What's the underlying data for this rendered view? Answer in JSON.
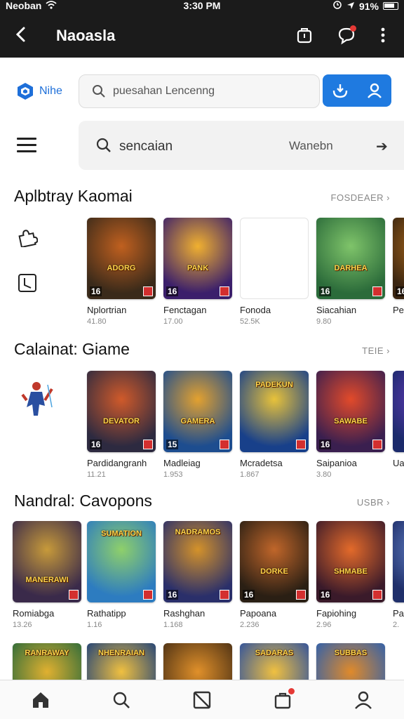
{
  "status": {
    "carrier": "Neoban",
    "time": "3:30 PM",
    "battery": "91%"
  },
  "appbar": {
    "title": "Naoasla"
  },
  "brand": {
    "name": "Nihe"
  },
  "search": {
    "placeholder": "puesahan Lencenng"
  },
  "search2": {
    "text": "sencaian",
    "hint": "Wanebn"
  },
  "sections": [
    {
      "title": "Aplbtray  Kaomai",
      "more": "FOSDEAER",
      "apps": [
        {
          "name": "Nplortrian",
          "meta": "41.80",
          "logo": "ADORG",
          "age": "16",
          "colors": [
            "#3a2a1a",
            "#c0601f"
          ]
        },
        {
          "name": "Fenctagan",
          "meta": "17.00",
          "logo": "PANK",
          "age": "16",
          "colors": [
            "#3b1f6b",
            "#f0b030"
          ]
        },
        {
          "name": "Fonoda",
          "meta": "52.5K",
          "logo": "",
          "age": "",
          "colors": [
            "#ffffff",
            "#ffffff"
          ]
        },
        {
          "name": "Siacahian",
          "meta": "9.80",
          "logo": "DARHEA",
          "age": "16",
          "colors": [
            "#2b6b3a",
            "#7fc46a"
          ]
        },
        {
          "name": "Pe",
          "meta": "",
          "logo": "",
          "age": "16",
          "colors": [
            "#3a2510",
            "#b8701c"
          ]
        }
      ]
    },
    {
      "title": "Calainat: Giame",
      "more": "TEIE",
      "apps": [
        {
          "name": "Pardidangranh",
          "meta": "11.21",
          "logo": "DEVATOR",
          "age": "16",
          "colors": [
            "#2d2a40",
            "#d05a2a"
          ]
        },
        {
          "name": "Madleiag",
          "meta": "1.953",
          "logo": "GAMERA",
          "age": "15",
          "colors": [
            "#1d4d8f",
            "#e3a12f"
          ]
        },
        {
          "name": "Mcradetsa",
          "meta": "1.867",
          "logo": "PADEKUN",
          "age": "",
          "colors": [
            "#18408a",
            "#e8c23a"
          ]
        },
        {
          "name": "Saipanioa",
          "meta": "3.80",
          "logo": "SAWABE",
          "age": "16",
          "colors": [
            "#3a1f4f",
            "#e24a2a"
          ]
        },
        {
          "name": "Ua",
          "meta": "",
          "logo": "",
          "age": "",
          "colors": [
            "#1b2a6b",
            "#6a3cc0"
          ]
        }
      ]
    },
    {
      "title": "Nandral: Cavopons",
      "more": "USBR",
      "apps": [
        {
          "name": "Romiabga",
          "meta": "13.26",
          "logo": "MANERAWI",
          "age": "",
          "colors": [
            "#3a2a4a",
            "#c79a3a"
          ]
        },
        {
          "name": "Rathatipp",
          "meta": "1.16",
          "logo": "SUMATION",
          "age": "",
          "colors": [
            "#2d7cc0",
            "#8fd06a"
          ]
        },
        {
          "name": "Rashghan",
          "meta": "1.168",
          "logo": "NADRAMOS",
          "age": "16",
          "colors": [
            "#2a2f6a",
            "#d4922a"
          ]
        },
        {
          "name": "Papoana",
          "meta": "2.236",
          "logo": "DORKE",
          "age": "16",
          "colors": [
            "#2a1f14",
            "#c0662a"
          ]
        },
        {
          "name": "Fapiohing",
          "meta": "2.96",
          "logo": "SHMABE",
          "age": "16",
          "colors": [
            "#3a1a2a",
            "#e36a2a"
          ]
        },
        {
          "name": "Pa",
          "meta": "2.",
          "logo": "",
          "age": "",
          "colors": [
            "#1f2f6a",
            "#6a8ad0"
          ]
        }
      ]
    },
    {
      "title": "",
      "more": "",
      "apps": [
        {
          "name": "",
          "meta": "",
          "logo": "RANRAWAY",
          "age": "",
          "colors": [
            "#2a6a3a",
            "#e0b030"
          ]
        },
        {
          "name": "",
          "meta": "",
          "logo": "NHENRAIAN",
          "age": "",
          "colors": [
            "#1b3f7a",
            "#f0c040"
          ]
        },
        {
          "name": "",
          "meta": "",
          "logo": "",
          "age": "",
          "colors": [
            "#4a2f14",
            "#e0902a"
          ]
        },
        {
          "name": "",
          "meta": "",
          "logo": "SADARAS",
          "age": "",
          "colors": [
            "#2a4fa0",
            "#f0c040"
          ]
        },
        {
          "name": "",
          "meta": "",
          "logo": "SUBBAS",
          "age": "",
          "colors": [
            "#2a5fb0",
            "#e08a2a"
          ]
        }
      ]
    }
  ]
}
